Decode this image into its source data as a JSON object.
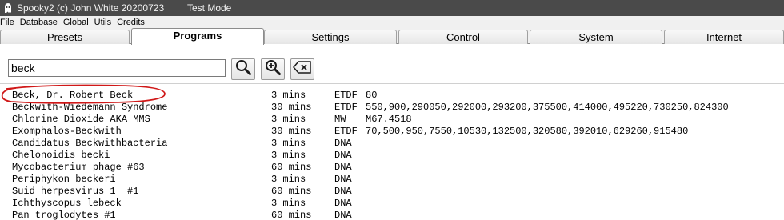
{
  "window": {
    "title": "Spooky2 (c) John White 20200723",
    "mode": "Test Mode"
  },
  "menu": {
    "items": [
      {
        "first": "F",
        "rest": "ile"
      },
      {
        "first": "D",
        "rest": "atabase"
      },
      {
        "first": "G",
        "rest": "lobal"
      },
      {
        "first": "U",
        "rest": "tils"
      },
      {
        "first": "C",
        "rest": "redits"
      }
    ]
  },
  "tabs": [
    "Presets",
    "Programs",
    "Settings",
    "Control",
    "System",
    "Internet"
  ],
  "active_tab": "Programs",
  "search": {
    "value": "beck"
  },
  "toolbar": {
    "search_icon": "magnifier-icon",
    "zoom_icon": "magnifier-plus-icon",
    "clear_icon": "backspace-clear-icon"
  },
  "results": [
    {
      "name": "Beck, Dr. Robert Beck",
      "duration": "3 mins",
      "type": "ETDF",
      "values": "80"
    },
    {
      "name": "Beckwith-Wiedemann Syndrome",
      "duration": "30 mins",
      "type": "ETDF",
      "values": "550,900,290050,292000,293200,375500,414000,495220,730250,824300"
    },
    {
      "name": "Chlorine Dioxide AKA MMS",
      "duration": "3 mins",
      "type": "MW",
      "values": "M67.4518"
    },
    {
      "name": "Exomphalos-Beckwith",
      "duration": "30 mins",
      "type": "ETDF",
      "values": "70,500,950,7550,10530,132500,320580,392010,629260,915480"
    },
    {
      "name": "Candidatus Beckwithbacteria",
      "duration": "3 mins",
      "type": "DNA",
      "values": ""
    },
    {
      "name": "Chelonoidis becki",
      "duration": "3 mins",
      "type": "DNA",
      "values": ""
    },
    {
      "name": "Mycobacterium phage #63",
      "duration": "60 mins",
      "type": "DNA",
      "values": ""
    },
    {
      "name": "Periphykon beckeri",
      "duration": "3 mins",
      "type": "DNA",
      "values": ""
    },
    {
      "name": "Suid herpesvirus 1  #1",
      "duration": "60 mins",
      "type": "DNA",
      "values": ""
    },
    {
      "name": "Ichthyscopus lebeck",
      "duration": "3 mins",
      "type": "DNA",
      "values": ""
    },
    {
      "name": "Pan troglodytes #1",
      "duration": "60 mins",
      "type": "DNA",
      "values": ""
    }
  ],
  "colors": {
    "titlebar": "#4a4a4a",
    "highlight_ellipse": "#d01818"
  }
}
